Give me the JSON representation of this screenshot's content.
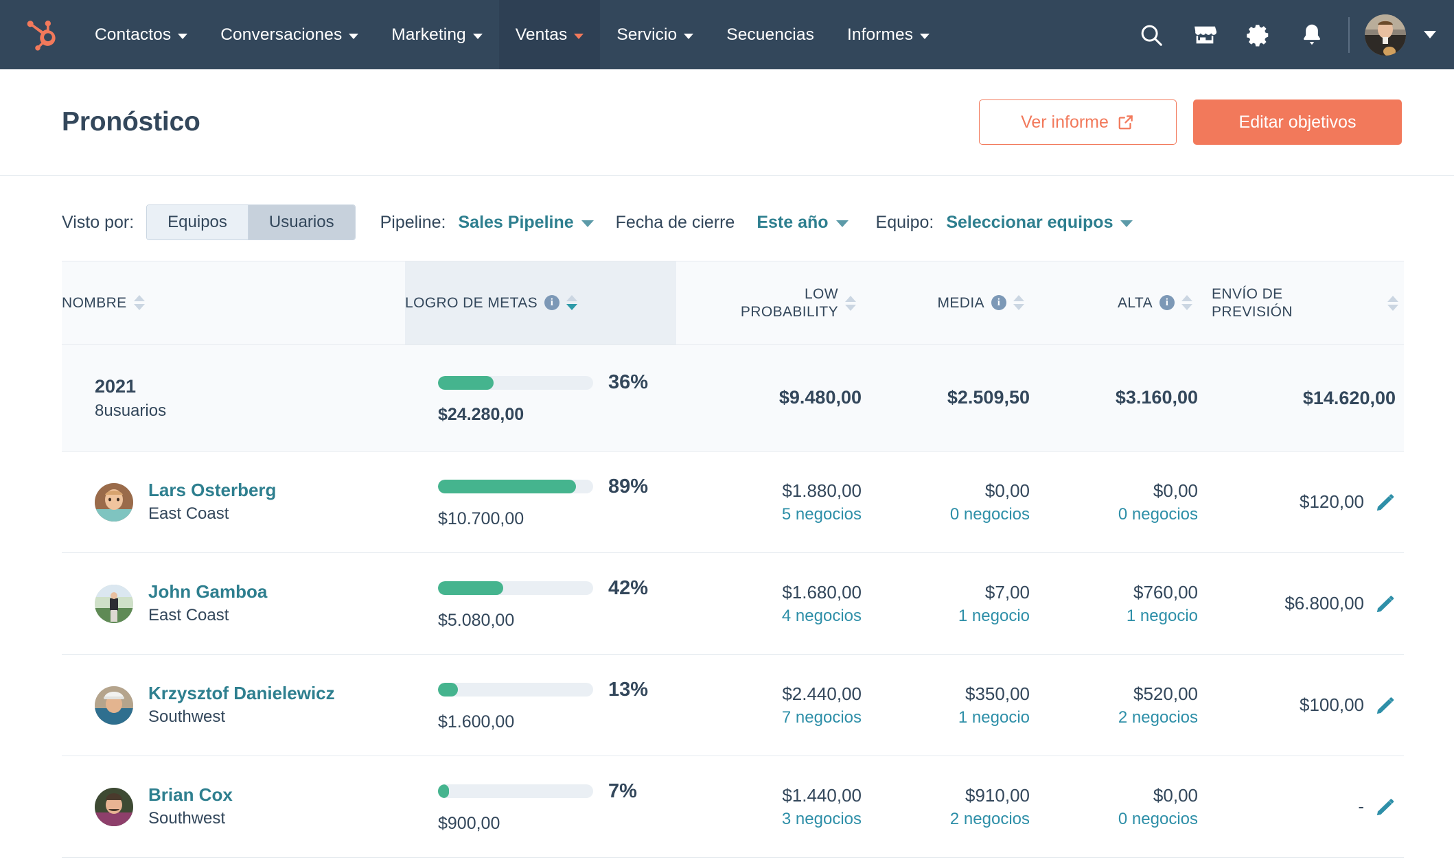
{
  "nav": {
    "logo_icon": "hubspot-sprocket-logo",
    "items": [
      {
        "label": "Contactos",
        "has_caret": true,
        "active": false
      },
      {
        "label": "Conversaciones",
        "has_caret": true,
        "active": false
      },
      {
        "label": "Marketing",
        "has_caret": true,
        "active": false
      },
      {
        "label": "Ventas",
        "has_caret": true,
        "active": true
      },
      {
        "label": "Servicio",
        "has_caret": true,
        "active": false
      },
      {
        "label": "Secuencias",
        "has_caret": false,
        "active": false
      },
      {
        "label": "Informes",
        "has_caret": true,
        "active": false
      }
    ],
    "icons": [
      "search-icon",
      "marketplace-icon",
      "settings-gear-icon",
      "notifications-bell-icon"
    ],
    "avatar_alt": "user-avatar",
    "accent_color": "#f2795b",
    "bar_color": "#33475b"
  },
  "header": {
    "title": "Pronóstico",
    "view_report_label": "Ver informe",
    "view_report_icon": "external-link-icon",
    "edit_goals_label": "Editar objetivos"
  },
  "filters": {
    "viewed_by_label": "Visto por:",
    "toggle": {
      "options": [
        "Equipos",
        "Usuarios"
      ],
      "selected": "Usuarios"
    },
    "pipeline_label": "Pipeline:",
    "pipeline_value": "Sales Pipeline",
    "close_date_label": "Fecha de cierre",
    "date_range_value": "Este año",
    "team_label": "Equipo:",
    "team_value": "Seleccionar equipos"
  },
  "table": {
    "columns": {
      "name": "NOMBRE",
      "goal": "LOGRO DE METAS",
      "low": "LOW PROBABILITY",
      "low_line1": "LOW",
      "low_line2": "PROBABILITY",
      "media": "MEDIA",
      "alta": "ALTA",
      "envio_line1": "ENVÍO DE",
      "envio_line2": "PREVISIÓN"
    },
    "summary": {
      "year": "2021",
      "users": "8usuarios",
      "goal_pct": "36%",
      "goal_pct_value": 36,
      "goal_amount": "$24.280,00",
      "low": "$9.480,00",
      "media": "$2.509,50",
      "alta": "$3.160,00",
      "envio": "$14.620,00"
    },
    "rows": [
      {
        "name": "Lars Osterberg",
        "team": "East Coast",
        "goal_pct": "89%",
        "goal_pct_value": 89,
        "goal_amount": "$10.700,00",
        "low": "$1.880,00",
        "low_deals": "5 negocios",
        "media": "$0,00",
        "media_deals": "0 negocios",
        "alta": "$0,00",
        "alta_deals": "0 negocios",
        "envio": "$120,00"
      },
      {
        "name": "John Gamboa",
        "team": "East Coast",
        "goal_pct": "42%",
        "goal_pct_value": 42,
        "goal_amount": "$5.080,00",
        "low": "$1.680,00",
        "low_deals": "4 negocios",
        "media": "$7,00",
        "media_deals": "1 negocio",
        "alta": "$760,00",
        "alta_deals": "1 negocio",
        "envio": "$6.800,00"
      },
      {
        "name": "Krzysztof Danielewicz",
        "team": "Southwest",
        "goal_pct": "13%",
        "goal_pct_value": 13,
        "goal_amount": "$1.600,00",
        "low": "$2.440,00",
        "low_deals": "7 negocios",
        "media": "$350,00",
        "media_deals": "1 negocio",
        "alta": "$520,00",
        "alta_deals": "2 negocios",
        "envio": "$100,00"
      },
      {
        "name": "Brian Cox",
        "team": "Southwest",
        "goal_pct": "7%",
        "goal_pct_value": 7,
        "goal_amount": "$900,00",
        "low": "$1.440,00",
        "low_deals": "3 negocios",
        "media": "$910,00",
        "media_deals": "2 negocios",
        "alta": "$0,00",
        "alta_deals": "0 negocios",
        "envio": "-"
      }
    ],
    "colors": {
      "progress_fill": "#45b48e",
      "progress_track": "#eaeff4",
      "link": "#2e7f8f",
      "sort_active": "#2e9aa8"
    }
  }
}
